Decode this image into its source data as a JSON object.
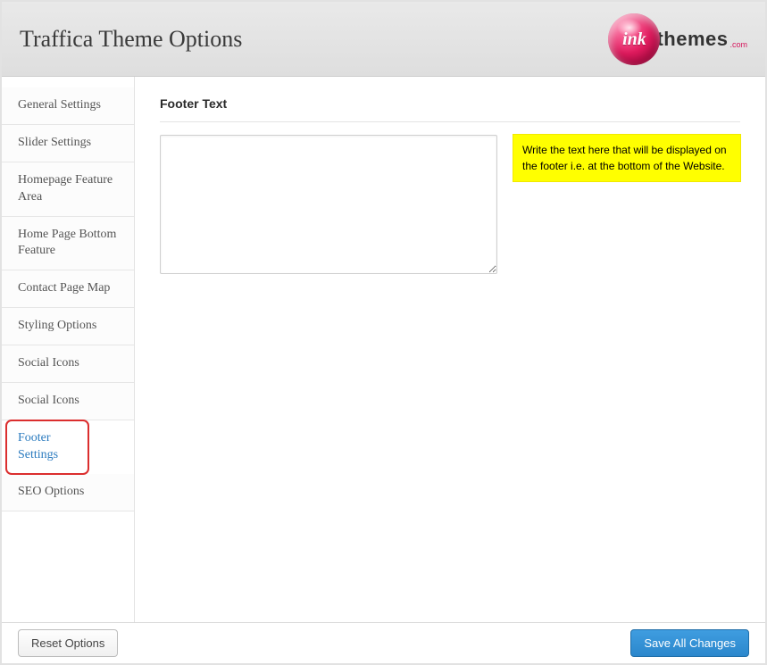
{
  "header": {
    "title": "Traffica Theme Options",
    "logo_ink": "ink",
    "logo_themes": "themes",
    "logo_dotcom": ".com"
  },
  "sidebar": {
    "items": [
      {
        "label": "General Settings"
      },
      {
        "label": "Slider Settings"
      },
      {
        "label": "Homepage Feature Area"
      },
      {
        "label": "Home Page Bottom Feature"
      },
      {
        "label": "Contact Page Map"
      },
      {
        "label": "Styling Options"
      },
      {
        "label": "Social Icons"
      },
      {
        "label": "Social Icons"
      },
      {
        "label": "Footer Settings"
      },
      {
        "label": "SEO Options"
      }
    ],
    "active_index": 8
  },
  "main": {
    "section_title": "Footer Text",
    "textarea_value": "",
    "textarea_placeholder": "",
    "help_text": "Write the text here that will be displayed on the footer i.e. at the bottom of the Website."
  },
  "footer": {
    "reset_label": "Reset Options",
    "save_label": "Save All Changes"
  }
}
